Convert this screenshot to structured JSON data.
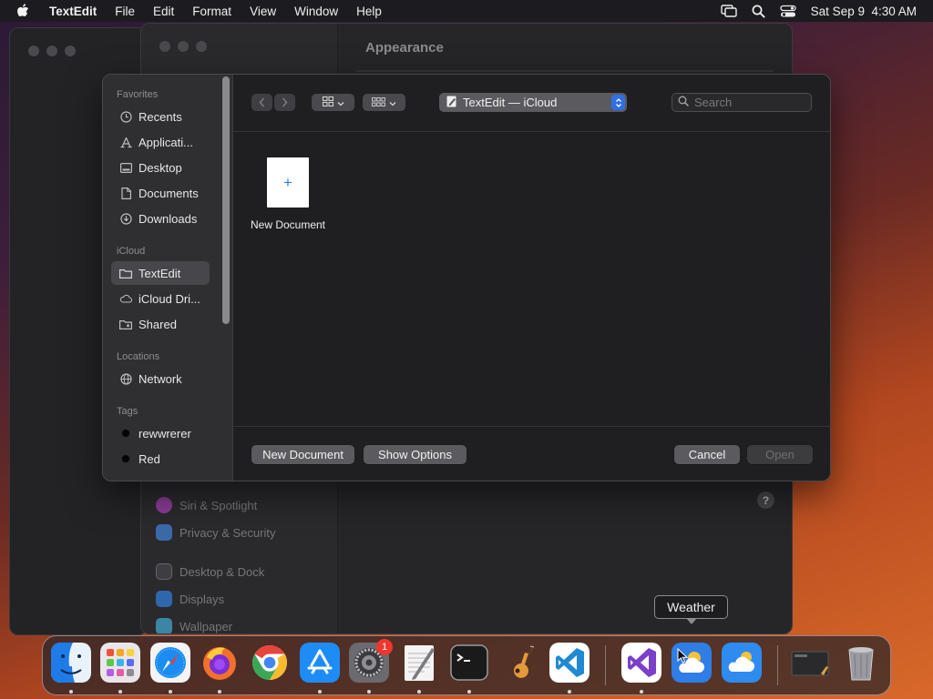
{
  "menubar": {
    "app_name": "TextEdit",
    "items": [
      "File",
      "Edit",
      "Format",
      "View",
      "Window",
      "Help"
    ],
    "datetime": "Sat Sep 9  4:30 AM"
  },
  "settings_window": {
    "title": "Appearance",
    "sidebar_items": [
      {
        "label": "Siri & Spotlight",
        "color": "#c94bd6"
      },
      {
        "label": "Privacy & Security",
        "color": "#4a8fe8"
      },
      {
        "label": "Desktop & Dock",
        "color": "#3d3d42"
      },
      {
        "label": "Displays",
        "color": "#3a86e6"
      },
      {
        "label": "Wallpaper",
        "color": "#3fb4d6"
      }
    ],
    "help_label": "?"
  },
  "dialog": {
    "sidebar": {
      "sections": [
        {
          "title": "Favorites",
          "items": [
            {
              "label": "Recents",
              "icon": "clock-icon"
            },
            {
              "label": "Applicati...",
              "icon": "applications-icon"
            },
            {
              "label": "Desktop",
              "icon": "desktop-icon"
            },
            {
              "label": "Documents",
              "icon": "document-icon"
            },
            {
              "label": "Downloads",
              "icon": "download-icon"
            }
          ]
        },
        {
          "title": "iCloud",
          "items": [
            {
              "label": "TextEdit",
              "icon": "folder-icon",
              "selected": true
            },
            {
              "label": "iCloud Dri...",
              "icon": "cloud-icon"
            },
            {
              "label": "Shared",
              "icon": "shared-folder-icon"
            }
          ]
        },
        {
          "title": "Locations",
          "items": [
            {
              "label": "Network",
              "icon": "globe-icon"
            }
          ]
        },
        {
          "title": "Tags",
          "items": [
            {
              "label": "rewwrerer",
              "icon": "tag-dot"
            },
            {
              "label": "Red",
              "icon": "tag-dot"
            }
          ]
        }
      ]
    },
    "location": "TextEdit — iCloud",
    "search_placeholder": "Search",
    "files": [
      {
        "label": "New Document",
        "thumb_glyph": "+"
      }
    ],
    "buttons": {
      "new_document": "New Document",
      "show_options": "Show Options",
      "cancel": "Cancel",
      "open": "Open"
    }
  },
  "dock": {
    "tooltip": "Weather",
    "badge_count": "1",
    "apps": [
      {
        "name": "Finder",
        "icon": "finder-icon",
        "color": "#2f8cf0",
        "running": true
      },
      {
        "name": "Launchpad",
        "icon": "launchpad-icon",
        "color": "#e8e6ea",
        "running": true
      },
      {
        "name": "Safari",
        "icon": "safari-icon",
        "color": "#1b8cf2",
        "running": true
      },
      {
        "name": "Firefox",
        "icon": "firefox-icon",
        "color": "#f2702a",
        "running": true
      },
      {
        "name": "Chrome",
        "icon": "chrome-icon",
        "color": "#ffffff",
        "running": false
      },
      {
        "name": "App Store",
        "icon": "app-store-icon",
        "color": "#1e8cf5",
        "running": true
      },
      {
        "name": "System Settings",
        "icon": "system-settings-icon",
        "color": "#8e8e93",
        "running": true
      },
      {
        "name": "TextEdit",
        "icon": "textedit-icon",
        "color": "#f4f4f4",
        "running": true
      },
      {
        "name": "Terminal",
        "icon": "terminal-icon",
        "color": "#1a1a1a",
        "running": true
      },
      {
        "name": "GarageBand",
        "icon": "garageband-icon",
        "color": "#3a2a22",
        "running": false
      },
      {
        "name": "Visual Studio Code",
        "icon": "vscode-icon",
        "color": "#ffffff",
        "running": true
      },
      {
        "name": "Visual Studio",
        "icon": "visual-studio-icon",
        "color": "#ffffff",
        "running": true
      },
      {
        "name": "Weather",
        "icon": "weather-icon",
        "color": "#2f7de6",
        "running": false
      },
      {
        "name": "Weather",
        "icon": "weather-icon",
        "color": "#2e8cf0",
        "running": false
      },
      {
        "name": "Screenshot Preview",
        "icon": "preview-icon",
        "color": "#2a2a2d",
        "running": false
      },
      {
        "name": "Trash",
        "icon": "trash-icon",
        "color": "#8a8a8e",
        "running": false
      }
    ]
  }
}
